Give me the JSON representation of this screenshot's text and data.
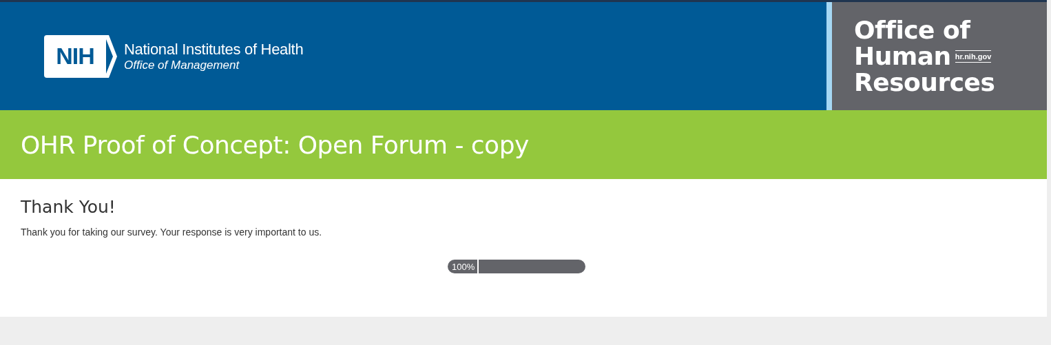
{
  "header": {
    "logo_mark": "NIH",
    "logo_title": "National Institutes of Health",
    "logo_subtitle": "Office of Management",
    "office_lines": [
      "Office of",
      "Human",
      "Resources"
    ],
    "office_url": "hr.nih.gov"
  },
  "banner": {
    "title": "OHR Proof of Concept: Open Forum - copy"
  },
  "content": {
    "heading": "Thank You!",
    "message": "Thank you for taking our survey. Your response is very important to us."
  },
  "progress": {
    "label": "100%"
  }
}
